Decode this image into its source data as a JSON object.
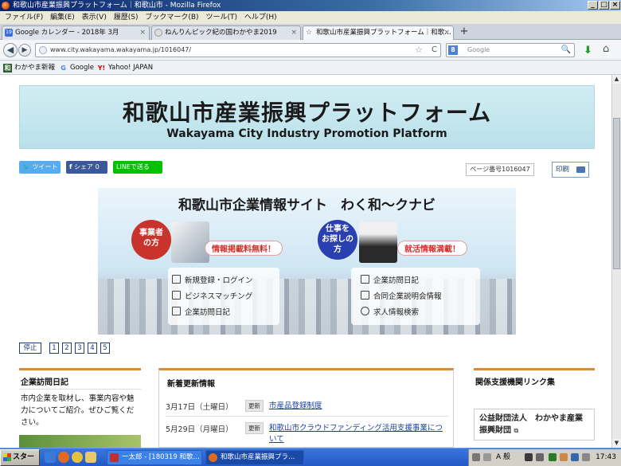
{
  "window": {
    "title": "和歌山市産業振興プラットフォーム｜和歌山市 - Mozilla Firefox",
    "min": "_",
    "max": "□",
    "close": "×"
  },
  "menu": [
    "ファイル(F)",
    "編集(E)",
    "表示(V)",
    "履歴(S)",
    "ブックマーク(B)",
    "ツール(T)",
    "ヘルプ(H)"
  ],
  "tabs": [
    {
      "label": "Google カレンダー - 2018年 3月",
      "icon_color": "#3a6fd8",
      "icon_text": "19",
      "close": "×"
    },
    {
      "label": "ねんりんピック紀の国わかやま2019",
      "icon_color": "#e6e6e6",
      "icon_text": "",
      "close": "×"
    },
    {
      "label": "和歌山市産業振興プラットフォーム｜和歌…",
      "icon_color": "#f5f7fa",
      "icon_text": "☆",
      "close": "×"
    }
  ],
  "newtab": "+",
  "nav": {
    "back": "◀",
    "forward": "▶",
    "url": "www.city.wakayama.wakayama.jp/1016047/",
    "star": "☆",
    "reload": "C",
    "search_placeholder": "Google",
    "search_engine": "8",
    "magnifier": "🔍",
    "download": "⬇",
    "home": "⌂"
  },
  "bookmarks": [
    {
      "label": "わかやま新報",
      "icon": "和",
      "color": "#2c5a2c"
    },
    {
      "label": "Google",
      "icon": "G",
      "color": "#fff"
    },
    {
      "label": "Yahoo! JAPAN",
      "icon": "Y!",
      "color": "#fff"
    }
  ],
  "site": {
    "banner_title": "和歌山市産業振興プラットフォーム",
    "banner_subtitle": "Wakayama City Industry Promotion Platform",
    "share": {
      "tweet": "ツイート",
      "fb": "シェア 0",
      "line": "LINEで送る"
    },
    "page_number": "ページ番号1016047",
    "print": "印刷",
    "hero": {
      "title": "和歌山市企業情報サイト　わく和～クナビ",
      "left_circle": "事業者\nの方",
      "left_pill": "情報掲載料無料！",
      "left_items": [
        "新規登録・ログイン",
        "ビジネスマッチング",
        "企業訪問日記"
      ],
      "right_circle": "仕事を\nお探しの\n方",
      "right_pill": "就活情報満載！",
      "right_items": [
        "企業訪問日記",
        "合同企業説明会情報",
        "求人情報検索"
      ]
    },
    "slider": {
      "stop": "停止",
      "pages": [
        "1",
        "2",
        "3",
        "4",
        "5"
      ]
    },
    "left_box": {
      "title": "企業訪問日記",
      "body": "市内企業を取材し、事業内容や魅力についてご紹介。ぜひご覧ください。"
    },
    "news": {
      "title": "新着更新情報",
      "items": [
        {
          "date": "3月17日（土曜日）",
          "badge": "更新",
          "link": "市産品登録制度"
        },
        {
          "date": "5月29日（月曜日）",
          "badge": "更新",
          "link": "和歌山市クラウドファンディング活用支援事業について"
        }
      ]
    },
    "right_box": {
      "title": "関係支援機関リンク集",
      "org": "公益財団法人　わかやま産業振興財団"
    }
  },
  "taskbar": {
    "start": "スタート",
    "tasks": [
      {
        "label": "一太郎 - [180319 和歌…",
        "color": "#c03030"
      },
      {
        "label": "和歌山市産業振興プラ…",
        "color": "#e06a20"
      }
    ],
    "tray_text": "A 般",
    "clock": "17:43"
  }
}
